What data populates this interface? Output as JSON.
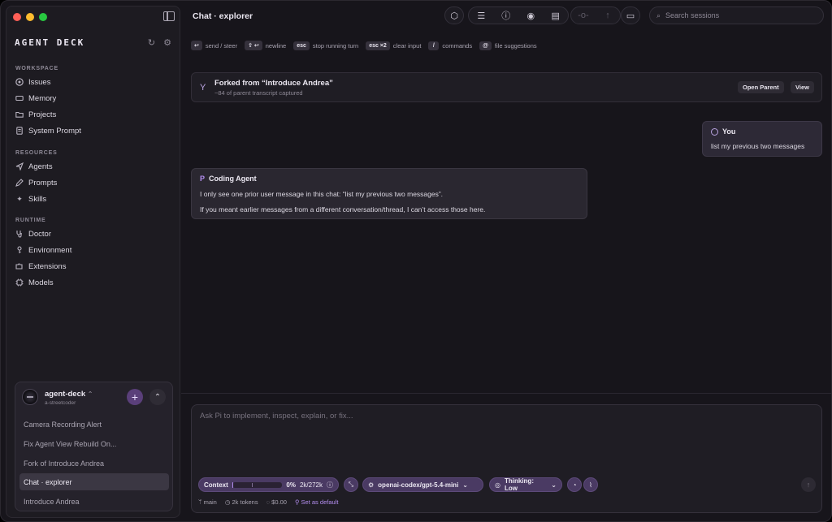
{
  "app": {
    "brand": "AGENT DECK",
    "header_title": "Chat · explorer"
  },
  "sidebar": {
    "sections": [
      {
        "label": "WORKSPACE",
        "items": [
          {
            "label": "Issues",
            "icon": "github-icon"
          },
          {
            "label": "Memory",
            "icon": "memory-icon"
          },
          {
            "label": "Projects",
            "icon": "folder-icon"
          },
          {
            "label": "System Prompt",
            "icon": "document-icon"
          }
        ]
      },
      {
        "label": "RESOURCES",
        "items": [
          {
            "label": "Agents",
            "icon": "send-icon"
          },
          {
            "label": "Prompts",
            "icon": "pen-icon"
          },
          {
            "label": "Skills",
            "icon": "sparkle-icon"
          }
        ]
      },
      {
        "label": "RUNTIME",
        "items": [
          {
            "label": "Doctor",
            "icon": "stethoscope-icon"
          },
          {
            "label": "Environment",
            "icon": "key-icon"
          },
          {
            "label": "Extensions",
            "icon": "puzzle-icon"
          },
          {
            "label": "Models",
            "icon": "chip-icon"
          }
        ]
      }
    ]
  },
  "project": {
    "name": "agent-deck",
    "name_chevron": "⌃",
    "owner": "a-streetcoder",
    "sessions": [
      {
        "label": "Camera Recording Alert",
        "active": false
      },
      {
        "label": "Fix Agent View Rebuild On...",
        "active": false
      },
      {
        "label": "Fork of Introduce Andrea",
        "active": false
      },
      {
        "label": "Chat · explorer",
        "active": true
      },
      {
        "label": "Introduce Andrea",
        "active": false
      }
    ]
  },
  "search": {
    "placeholder": "Search sessions"
  },
  "shortcuts": [
    {
      "key": "↩",
      "label": "send / steer"
    },
    {
      "key": "⇧ ↩",
      "label": "newline"
    },
    {
      "key": "esc",
      "label": "stop running turn"
    },
    {
      "key": "esc ×2",
      "label": "clear input"
    },
    {
      "key": "/",
      "label": "commands"
    },
    {
      "key": "@",
      "label": "file suggestions"
    }
  ],
  "fork": {
    "title": "Forked from “Introduce Andrea”",
    "subtitle": "~84 of parent transcript captured",
    "open_parent": "Open Parent",
    "view": "View"
  },
  "messages": {
    "user": {
      "author": "You",
      "text": "list my previous two messages"
    },
    "agent": {
      "author": "Coding Agent",
      "line1": "I only see one prior user message in this chat: “list my previous two messages”.",
      "line2": "If you meant earlier messages from a different conversation/thread, I can’t access those here."
    }
  },
  "composer": {
    "placeholder": "Ask Pi to implement, inspect, explain, or fix...",
    "context_label": "Context",
    "context_percent": "0%",
    "context_tokens": "2k/272k",
    "context_fill": 0.007,
    "model": "openai-codex/gpt-5.4-mini",
    "thinking": "Thinking: Low",
    "status": {
      "branch": "main",
      "tokens": "2k tokens",
      "cost": "$0.00",
      "set_default": "Set as default"
    }
  },
  "colors": {
    "accent": "#b48ef0",
    "pill_bg": "#4a3a63",
    "window_bg": "#17151b"
  }
}
